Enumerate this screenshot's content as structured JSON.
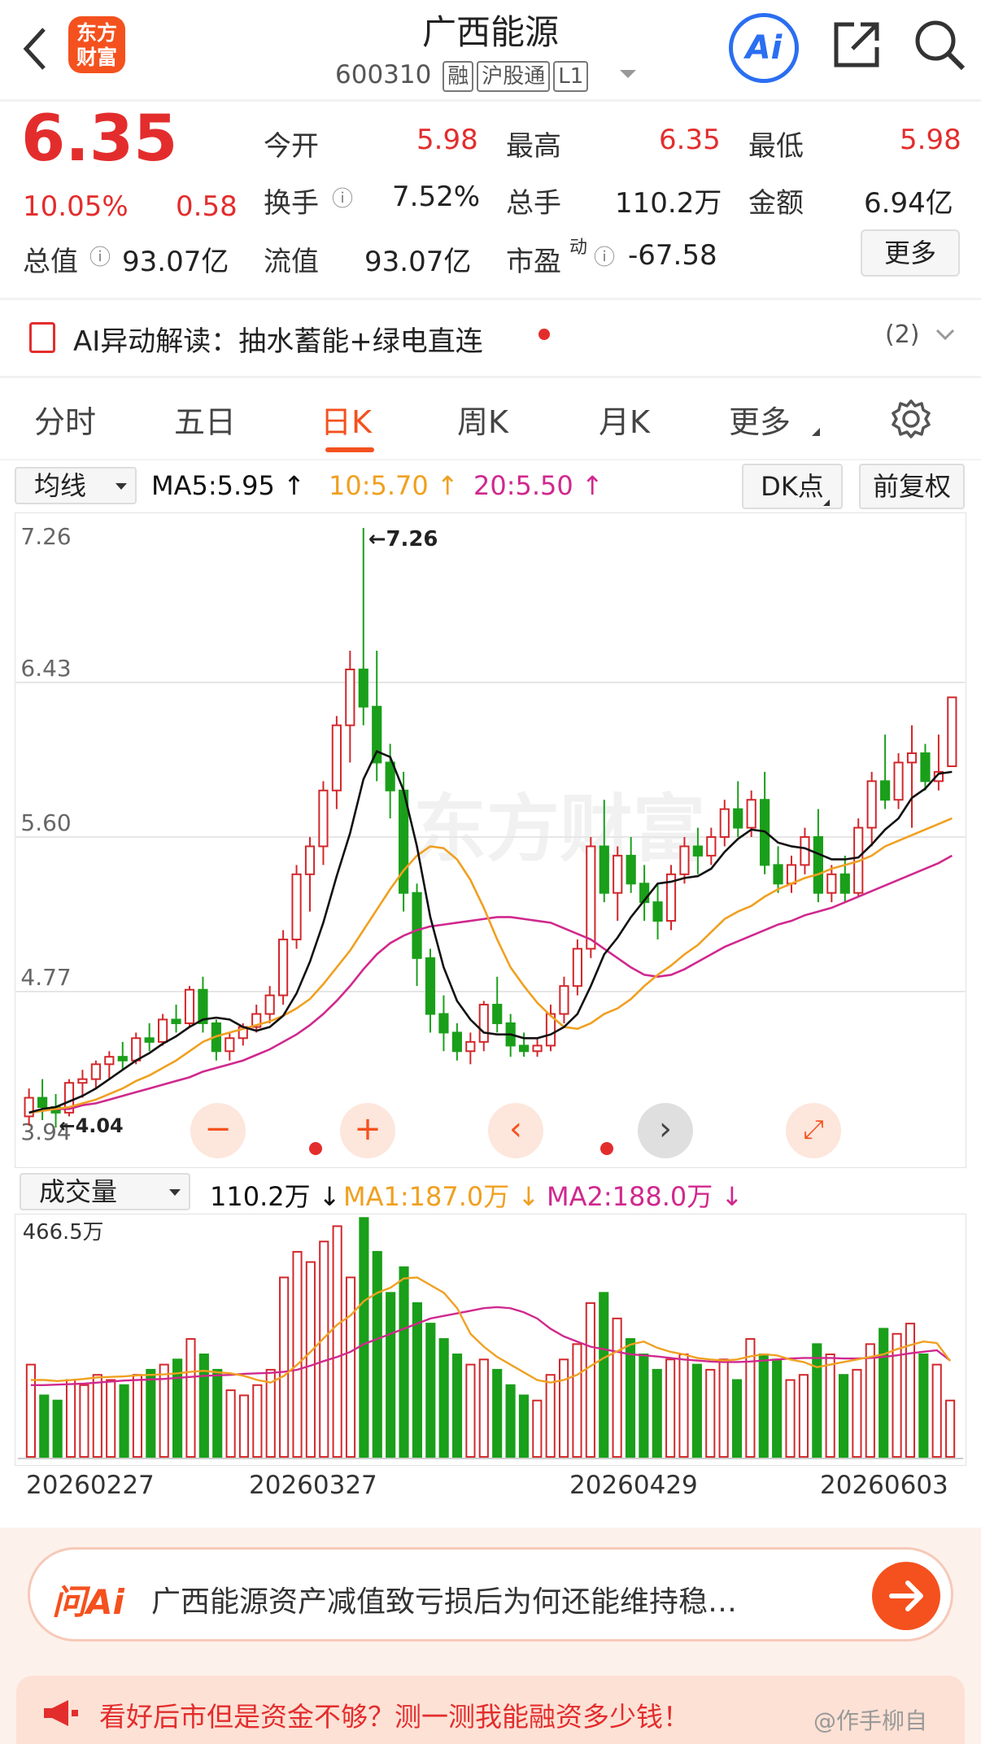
{
  "header": {
    "title": "广西能源",
    "code": "600310",
    "tags": [
      "融",
      "沪股通",
      "L1"
    ],
    "logo": "东方财富",
    "ai_label": "Ai"
  },
  "quote": {
    "price": "6.35",
    "change_pct": "10.05%",
    "change": "0.58",
    "rows": [
      [
        {
          "k": "今开",
          "v": "5.98",
          "c": "red"
        },
        {
          "k": "最高",
          "v": "6.35",
          "c": "red"
        },
        {
          "k": "最低",
          "v": "5.98",
          "c": "red"
        }
      ],
      [
        {
          "k": "换手",
          "v": "7.52%",
          "c": "dk"
        },
        {
          "k": "总手",
          "v": "110.2万",
          "c": "dk"
        },
        {
          "k": "金额",
          "v": "6.94亿",
          "c": "dk"
        }
      ],
      [
        {
          "k": "流值",
          "v": "93.07亿",
          "c": "dk"
        },
        {
          "k": "市盈",
          "v": "-67.58",
          "c": "dk"
        }
      ]
    ],
    "total_label": "总值",
    "total_value": "93.07亿",
    "pe_sup": "动",
    "more_label": "更多"
  },
  "ai_line": {
    "text": "AI异动解读：抽水蓄能+绿电直连",
    "count": "(2)"
  },
  "tabs": [
    "分时",
    "五日",
    "日K",
    "周K",
    "月K",
    "更多"
  ],
  "ma": {
    "selector": "均线",
    "ma5": "MA5:5.95",
    "ma10": "10:5.70",
    "ma20": "20:5.50",
    "dk": "DK点",
    "fq": "前复权"
  },
  "vol": {
    "selector": "成交量",
    "v": "110.2万",
    "ma1": "MA1:187.0万",
    "ma2": "MA2:188.0万",
    "ymax": "466.5万"
  },
  "chart_data": {
    "type": "candlestick",
    "yticks": [
      "7.26",
      "6.43",
      "5.60",
      "4.77",
      "3.94"
    ],
    "ymin": 3.94,
    "ymax": 7.26,
    "max_annot": "←7.26",
    "min_annot": "←4.04",
    "dates": [
      "20260227",
      "20260327",
      "20260429",
      "20260603"
    ],
    "colors": {
      "up": "#d2272b",
      "down": "#1a9f1a",
      "ma5": "#111111",
      "ma10": "#f0a020",
      "ma20": "#d0288e"
    },
    "candles": [
      [
        4.1,
        4.25,
        4.05,
        4.2,
        180
      ],
      [
        4.2,
        4.3,
        4.08,
        4.15,
        120
      ],
      [
        4.15,
        4.22,
        4.04,
        4.12,
        110
      ],
      [
        4.12,
        4.3,
        4.1,
        4.28,
        150
      ],
      [
        4.28,
        4.35,
        4.2,
        4.3,
        140
      ],
      [
        4.3,
        4.4,
        4.25,
        4.38,
        160
      ],
      [
        4.38,
        4.45,
        4.3,
        4.42,
        150
      ],
      [
        4.42,
        4.5,
        4.35,
        4.4,
        140
      ],
      [
        4.4,
        4.55,
        4.38,
        4.52,
        160
      ],
      [
        4.52,
        4.6,
        4.45,
        4.5,
        170
      ],
      [
        4.5,
        4.65,
        4.48,
        4.62,
        180
      ],
      [
        4.62,
        4.7,
        4.55,
        4.6,
        190
      ],
      [
        4.6,
        4.8,
        4.58,
        4.78,
        230
      ],
      [
        4.78,
        4.85,
        4.55,
        4.6,
        200
      ],
      [
        4.6,
        4.62,
        4.4,
        4.45,
        170
      ],
      [
        4.45,
        4.55,
        4.4,
        4.52,
        130
      ],
      [
        4.52,
        4.6,
        4.48,
        4.58,
        120
      ],
      [
        4.58,
        4.7,
        4.55,
        4.65,
        140
      ],
      [
        4.65,
        4.8,
        4.6,
        4.75,
        170
      ],
      [
        4.75,
        5.1,
        4.7,
        5.05,
        350
      ],
      [
        5.05,
        5.45,
        5.0,
        5.4,
        400
      ],
      [
        5.4,
        5.6,
        5.2,
        5.55,
        380
      ],
      [
        5.55,
        5.9,
        5.45,
        5.85,
        420
      ],
      [
        5.85,
        6.25,
        5.75,
        6.2,
        450
      ],
      [
        6.2,
        6.6,
        6.0,
        6.5,
        350
      ],
      [
        6.5,
        7.26,
        6.2,
        6.3,
        466
      ],
      [
        6.3,
        6.6,
        5.9,
        6.0,
        400
      ],
      [
        6.0,
        6.1,
        5.7,
        5.85,
        320
      ],
      [
        5.85,
        5.95,
        5.2,
        5.3,
        370
      ],
      [
        5.3,
        5.35,
        4.8,
        4.95,
        300
      ],
      [
        4.95,
        5.0,
        4.55,
        4.65,
        260
      ],
      [
        4.65,
        4.75,
        4.45,
        4.55,
        230
      ],
      [
        4.55,
        4.6,
        4.4,
        4.45,
        200
      ],
      [
        4.45,
        4.55,
        4.38,
        4.5,
        180
      ],
      [
        4.5,
        4.72,
        4.45,
        4.7,
        190
      ],
      [
        4.7,
        4.85,
        4.55,
        4.6,
        170
      ],
      [
        4.6,
        4.65,
        4.42,
        4.48,
        140
      ],
      [
        4.48,
        4.55,
        4.42,
        4.45,
        120
      ],
      [
        4.45,
        4.52,
        4.42,
        4.48,
        110
      ],
      [
        4.48,
        4.7,
        4.45,
        4.65,
        160
      ],
      [
        4.65,
        4.85,
        4.6,
        4.8,
        190
      ],
      [
        4.8,
        5.05,
        4.75,
        5.0,
        220
      ],
      [
        5.0,
        5.6,
        4.95,
        5.55,
        300
      ],
      [
        5.55,
        5.8,
        5.25,
        5.3,
        320
      ],
      [
        5.3,
        5.55,
        5.15,
        5.5,
        270
      ],
      [
        5.5,
        5.6,
        5.3,
        5.35,
        230
      ],
      [
        5.35,
        5.45,
        5.15,
        5.25,
        200
      ],
      [
        5.25,
        5.35,
        5.05,
        5.15,
        170
      ],
      [
        5.15,
        5.45,
        5.1,
        5.4,
        190
      ],
      [
        5.4,
        5.6,
        5.35,
        5.55,
        200
      ],
      [
        5.55,
        5.65,
        5.4,
        5.5,
        180
      ],
      [
        5.5,
        5.65,
        5.45,
        5.6,
        170
      ],
      [
        5.6,
        5.8,
        5.55,
        5.75,
        190
      ],
      [
        5.75,
        5.9,
        5.6,
        5.65,
        150
      ],
      [
        5.65,
        5.85,
        5.6,
        5.8,
        230
      ],
      [
        5.8,
        5.95,
        5.4,
        5.45,
        200
      ],
      [
        5.45,
        5.55,
        5.3,
        5.35,
        190
      ],
      [
        5.35,
        5.5,
        5.3,
        5.45,
        150
      ],
      [
        5.45,
        5.65,
        5.4,
        5.6,
        160
      ],
      [
        5.6,
        5.75,
        5.25,
        5.3,
        220
      ],
      [
        5.3,
        5.45,
        5.25,
        5.4,
        200
      ],
      [
        5.4,
        5.5,
        5.25,
        5.3,
        160
      ],
      [
        5.3,
        5.7,
        5.28,
        5.65,
        170
      ],
      [
        5.65,
        5.95,
        5.55,
        5.9,
        220
      ],
      [
        5.9,
        6.15,
        5.75,
        5.8,
        250
      ],
      [
        5.8,
        6.05,
        5.75,
        6.0,
        240
      ],
      [
        6.0,
        6.2,
        5.65,
        6.05,
        260
      ],
      [
        6.05,
        6.1,
        5.85,
        5.9,
        200
      ],
      [
        5.9,
        6.15,
        5.85,
        5.95,
        180
      ],
      [
        5.98,
        6.35,
        5.98,
        6.35,
        110
      ]
    ],
    "ma5": [
      4.12,
      4.14,
      4.15,
      4.18,
      4.21,
      4.25,
      4.3,
      4.35,
      4.4,
      4.44,
      4.49,
      4.53,
      4.58,
      4.62,
      4.63,
      4.62,
      4.58,
      4.56,
      4.58,
      4.64,
      4.76,
      4.93,
      5.14,
      5.39,
      5.62,
      5.91,
      6.06,
      6.03,
      5.85,
      5.55,
      5.17,
      4.9,
      4.72,
      4.62,
      4.55,
      4.54,
      4.54,
      4.52,
      4.52,
      4.54,
      4.58,
      4.65,
      4.8,
      4.97,
      5.06,
      5.17,
      5.26,
      5.35,
      5.36,
      5.38,
      5.39,
      5.43,
      5.52,
      5.59,
      5.64,
      5.63,
      5.57,
      5.55,
      5.54,
      5.51,
      5.48,
      5.48,
      5.49,
      5.56,
      5.64,
      5.7,
      5.81,
      5.86,
      5.94,
      5.95
    ],
    "ma10": [
      4.12,
      4.13,
      4.14,
      4.15,
      4.17,
      4.19,
      4.22,
      4.25,
      4.29,
      4.32,
      4.36,
      4.4,
      4.45,
      4.5,
      4.53,
      4.55,
      4.57,
      4.59,
      4.61,
      4.64,
      4.68,
      4.73,
      4.81,
      4.9,
      4.99,
      5.1,
      5.21,
      5.32,
      5.42,
      5.5,
      5.55,
      5.54,
      5.48,
      5.37,
      5.22,
      5.05,
      4.9,
      4.8,
      4.71,
      4.64,
      4.58,
      4.57,
      4.6,
      4.65,
      4.68,
      4.73,
      4.8,
      4.86,
      4.91,
      4.97,
      5.02,
      5.09,
      5.16,
      5.2,
      5.23,
      5.28,
      5.32,
      5.35,
      5.38,
      5.4,
      5.43,
      5.45,
      5.47,
      5.5,
      5.55,
      5.58,
      5.61,
      5.64,
      5.67,
      5.7
    ],
    "ma20": [
      4.12,
      4.13,
      4.14,
      4.14,
      4.16,
      4.17,
      4.19,
      4.21,
      4.23,
      4.25,
      4.27,
      4.29,
      4.31,
      4.34,
      4.36,
      4.38,
      4.4,
      4.43,
      4.46,
      4.5,
      4.54,
      4.59,
      4.65,
      4.72,
      4.8,
      4.89,
      4.97,
      5.03,
      5.07,
      5.1,
      5.12,
      5.13,
      5.14,
      5.15,
      5.16,
      5.17,
      5.17,
      5.16,
      5.15,
      5.14,
      5.11,
      5.08,
      5.05,
      5.0,
      4.95,
      4.9,
      4.86,
      4.85,
      4.86,
      4.89,
      4.93,
      4.97,
      5.01,
      5.04,
      5.07,
      5.1,
      5.13,
      5.15,
      5.18,
      5.2,
      5.22,
      5.25,
      5.28,
      5.31,
      5.34,
      5.37,
      5.4,
      5.43,
      5.46,
      5.5
    ],
    "vma1": [
      150,
      150,
      148,
      150,
      152,
      155,
      156,
      157,
      159,
      160,
      161,
      163,
      166,
      168,
      165,
      163,
      158,
      150,
      145,
      158,
      180,
      205,
      232,
      258,
      276,
      304,
      320,
      330,
      348,
      350,
      335,
      320,
      290,
      240,
      215,
      195,
      180,
      165,
      150,
      145,
      150,
      160,
      177,
      193,
      206,
      219,
      225,
      213,
      205,
      200,
      193,
      190,
      188,
      190,
      196,
      200,
      198,
      190,
      185,
      175,
      180,
      185,
      190,
      195,
      200,
      210,
      218,
      225,
      222,
      187
    ],
    "vma2": [
      140,
      140,
      141,
      142,
      143,
      145,
      147,
      149,
      150,
      151,
      152,
      154,
      156,
      158,
      159,
      160,
      162,
      163,
      164,
      166,
      170,
      178,
      187,
      195,
      205,
      220,
      230,
      240,
      250,
      260,
      270,
      275,
      280,
      285,
      290,
      292,
      290,
      282,
      270,
      250,
      235,
      225,
      215,
      210,
      205,
      200,
      198,
      196,
      193,
      190,
      188,
      186,
      185,
      185,
      186,
      188,
      190,
      192,
      193,
      193,
      193,
      192,
      192,
      193,
      195,
      198,
      202,
      205,
      208,
      188
    ]
  },
  "bottom": {
    "ask_logo": "问Ai",
    "ask_text": "广西能源资产减值致亏损后为何还能维持稳…",
    "promo": "看好后市但是资金不够？测一测我能融资多少钱！",
    "watermark": "@作手柳自"
  }
}
